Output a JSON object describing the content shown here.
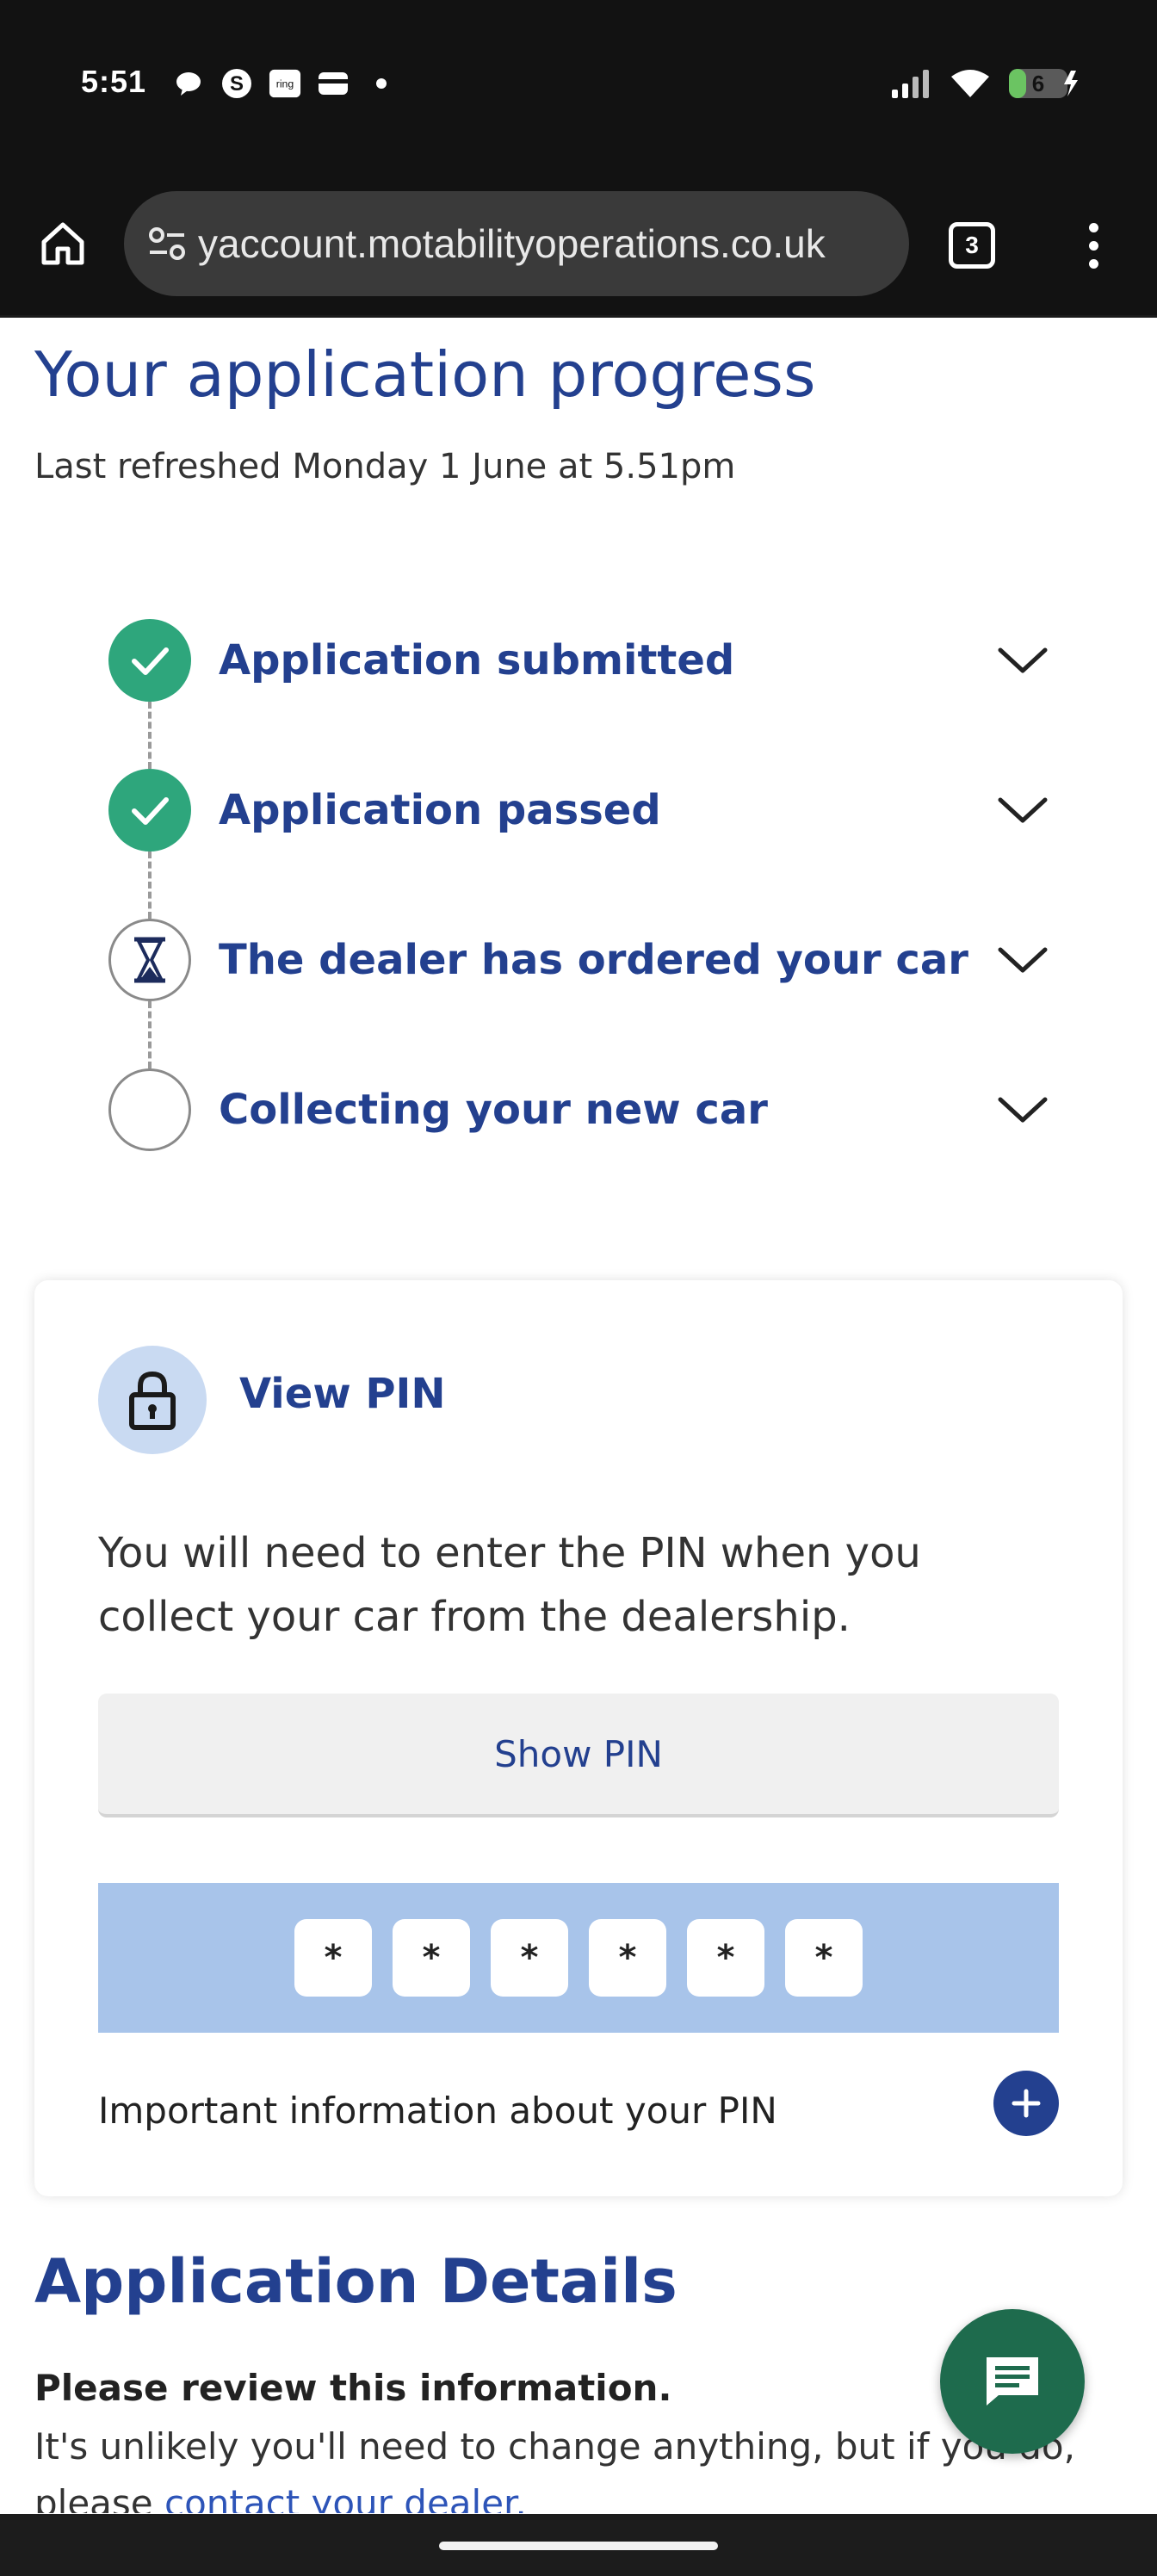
{
  "status_bar": {
    "time": "5:51",
    "left_icons": [
      "chat-bubble-icon",
      "skype-icon",
      "ring-icon",
      "wallet-icon",
      "dot-icon"
    ],
    "ring_label": "ring",
    "battery_level": "6"
  },
  "browser": {
    "url": "yaccount.motabilityoperations.co.uk",
    "tab_count": "3"
  },
  "page": {
    "title": "Your application progress",
    "last_refreshed": "Last refreshed Monday 1 June at 5.51pm"
  },
  "steps": [
    {
      "label": "Application submitted",
      "status": "done"
    },
    {
      "label": "Application passed",
      "status": "done"
    },
    {
      "label": "The dealer has ordered your car",
      "status": "current"
    },
    {
      "label": "Collecting your new car",
      "status": "pending"
    }
  ],
  "pin_card": {
    "title": "View PIN",
    "description": "You will need to enter the PIN when you collect your car from the dealership.",
    "show_button": "Show PIN",
    "digits": [
      "*",
      "*",
      "*",
      "*",
      "*",
      "*"
    ],
    "info_label": "Important information about your PIN"
  },
  "details": {
    "title": "Application Details",
    "bold_text": "Please review this information.",
    "text": "It's unlikely you'll need to change anything, but if you do, please ",
    "link": "contact your dealer."
  },
  "colors": {
    "brand_blue": "#23408f",
    "success_green": "#2ea67c",
    "pin_strip": "#a8c4ea",
    "chat_green": "#1e6b4d"
  }
}
